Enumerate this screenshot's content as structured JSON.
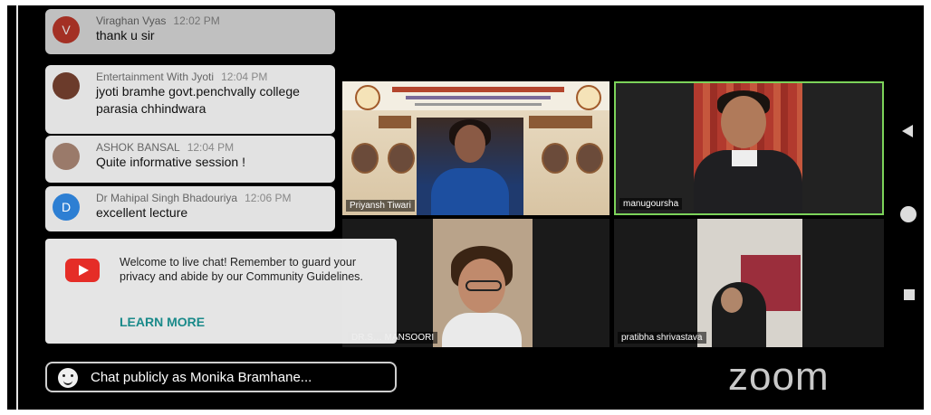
{
  "chat": [
    {
      "author": "Viraghan Vyas",
      "time": "12:02 PM",
      "message": "thank u sir",
      "avatar_letter": "V",
      "avatar_color": "#c0392b"
    },
    {
      "author": "Entertainment With Jyoti",
      "time": "12:04 PM",
      "message": "jyoti bramhe govt.penchvally college parasia chhindwara",
      "avatar_letter": "",
      "avatar_color": "#6b3b2b"
    },
    {
      "author": "ASHOK BANSAL",
      "time": "12:04 PM",
      "message": "Quite informative session !",
      "avatar_letter": "",
      "avatar_color": "#9a7a6a"
    },
    {
      "author": "Dr Mahipal Singh Bhadouriya",
      "time": "12:06 PM",
      "message": "excellent lecture",
      "avatar_letter": "D",
      "avatar_color": "#2d7fd3"
    }
  ],
  "welcome": {
    "text": "Welcome to live chat! Remember to guard your privacy and abide by our Community Guidelines.",
    "learn_more": "LEARN MORE"
  },
  "chat_input_placeholder": "Chat publicly as Monika Bramhane...",
  "participants": [
    {
      "name": "Priyansh Tiwari"
    },
    {
      "name": "manugoursha"
    },
    {
      "name": "DR.S… MANSOORI"
    },
    {
      "name": "pratibha shrivastava"
    }
  ],
  "brand": "zoom",
  "colors": {
    "active_speaker_border": "#7cd35a",
    "youtube_red": "#e52d27",
    "learn_more": "#1a8a8a"
  }
}
